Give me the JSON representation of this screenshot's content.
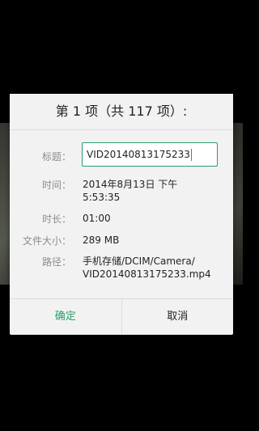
{
  "dialog": {
    "title": "第 1 项（共 117 项）:",
    "fields": {
      "title_label": "标题：",
      "title_value": "VID20140813175233",
      "time_label": "时间：",
      "time_value_line1": "2014年8月13日 下午",
      "time_value_line2": "5:53:35",
      "duration_label": "时长：",
      "duration_value": "01:00",
      "size_label": "文件大小：",
      "size_value": "289 MB",
      "path_label": "路径：",
      "path_value_line1": "手机存储/DCIM/Camera/",
      "path_value_line2": "VID20140813175233.mp4"
    },
    "buttons": {
      "ok": "确定",
      "cancel": "取消"
    }
  },
  "colors": {
    "accent": "#2a9d6a",
    "dialog_bg": "#f2f2f2"
  }
}
